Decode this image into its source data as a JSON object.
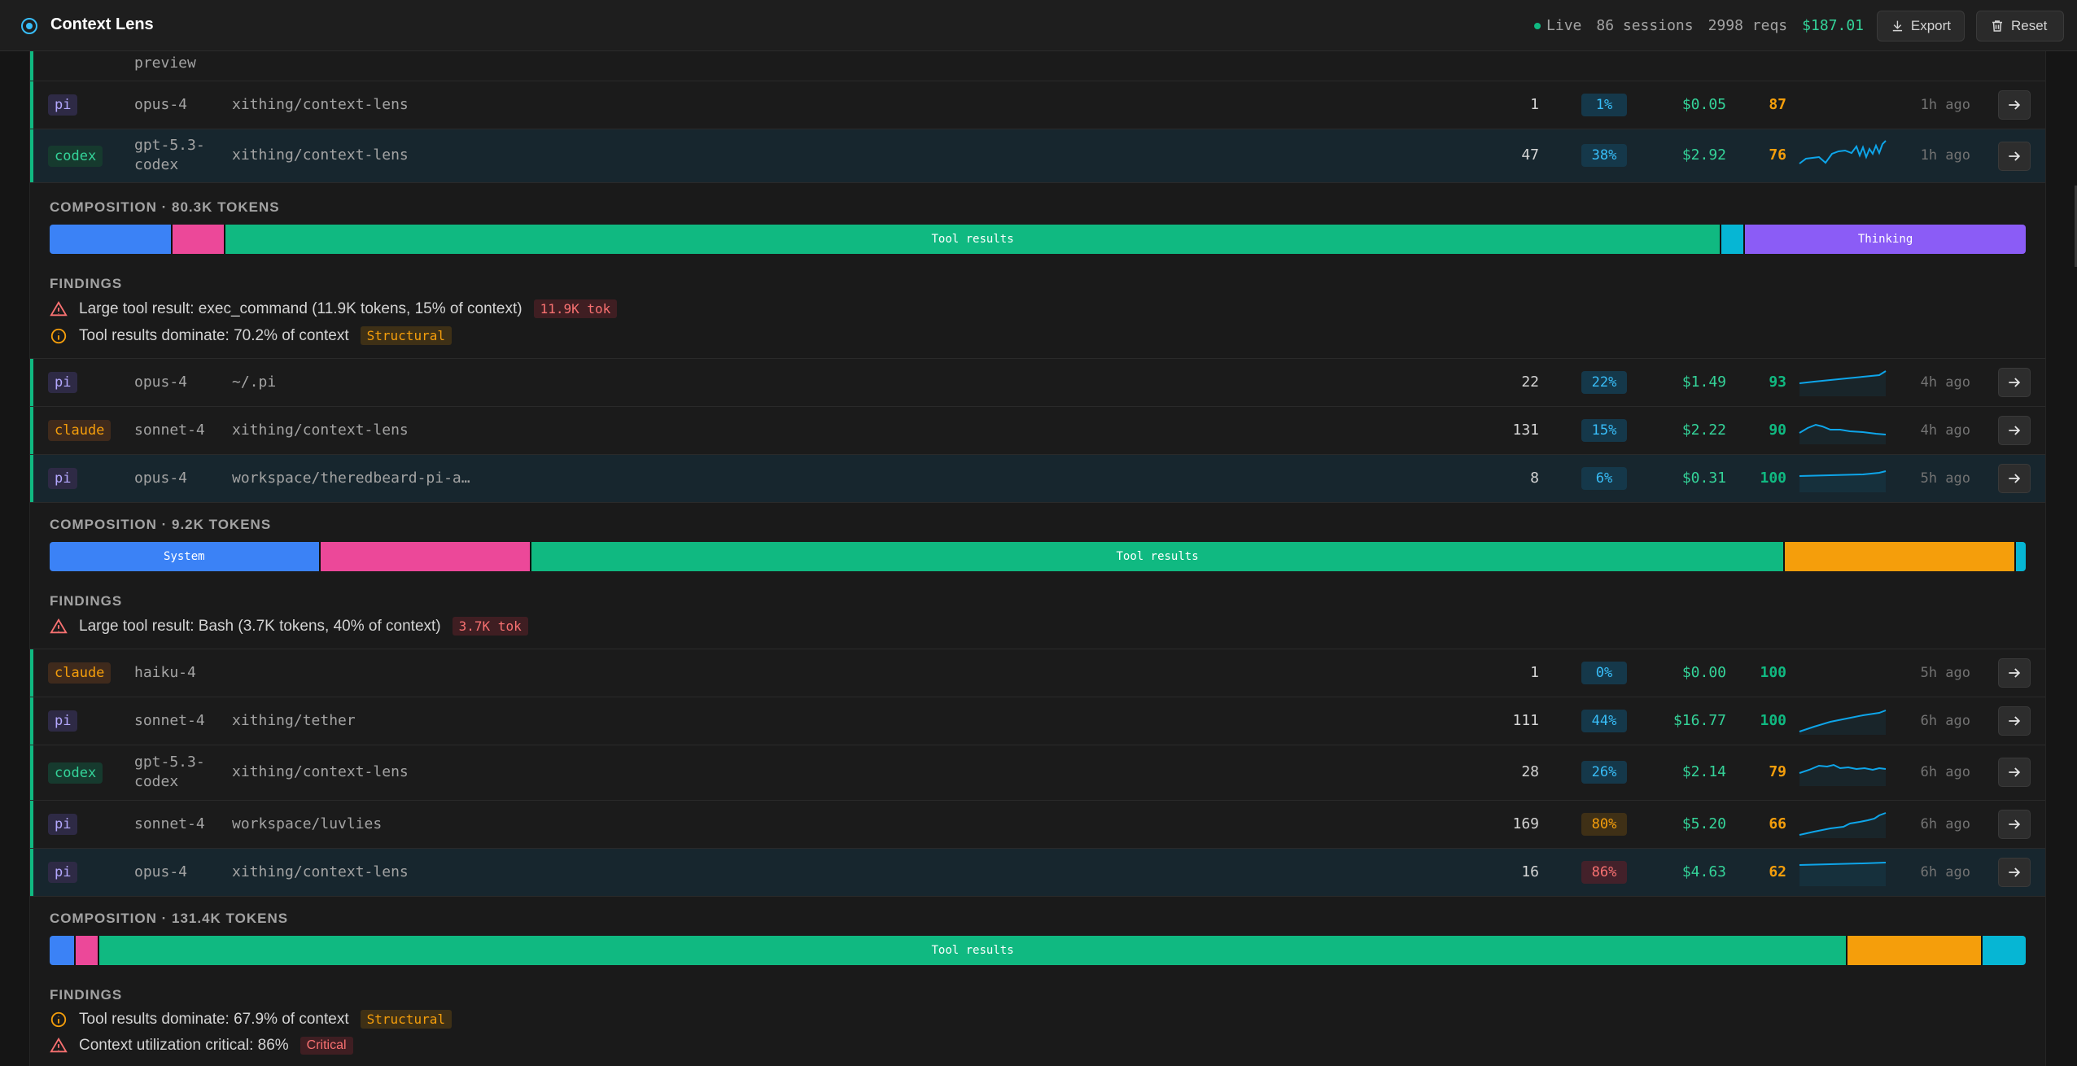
{
  "app": {
    "title": "Context Lens"
  },
  "header": {
    "live_label": "Live",
    "sessions": "86 sessions",
    "reqs": "2998 reqs",
    "cost": "$187.01",
    "export_label": "Export",
    "reset_label": "Reset"
  },
  "rows": [
    {
      "agent": "",
      "model": "preview",
      "project": "",
      "turns": "",
      "util": "",
      "cost": "",
      "score": "",
      "ago": ""
    },
    {
      "agent": "pi",
      "model": "opus-4",
      "project": "xithing/context-lens",
      "turns": "1",
      "util": "1%",
      "cost": "$0.05",
      "score": "87",
      "ago": "1h ago"
    },
    {
      "agent": "codex",
      "model_line1": "gpt-5.3-",
      "model_line2": "codex",
      "project": "xithing/context-lens",
      "turns": "47",
      "util": "38%",
      "cost": "$2.92",
      "score": "76",
      "ago": "1h ago"
    },
    {
      "agent": "pi",
      "model": "opus-4",
      "project": "~/.pi",
      "turns": "22",
      "util": "22%",
      "cost": "$1.49",
      "score": "93",
      "ago": "4h ago"
    },
    {
      "agent": "claude",
      "model": "sonnet-4",
      "project": "xithing/context-lens",
      "turns": "131",
      "util": "15%",
      "cost": "$2.22",
      "score": "90",
      "ago": "4h ago"
    },
    {
      "agent": "pi",
      "model": "opus-4",
      "project": "workspace/theredbeard-pi-a…",
      "turns": "8",
      "util": "6%",
      "cost": "$0.31",
      "score": "100",
      "ago": "5h ago"
    },
    {
      "agent": "claude",
      "model": "haiku-4",
      "project": "",
      "turns": "1",
      "util": "0%",
      "cost": "$0.00",
      "score": "100",
      "ago": "5h ago"
    },
    {
      "agent": "pi",
      "model": "sonnet-4",
      "project": "xithing/tether",
      "turns": "111",
      "util": "44%",
      "cost": "$16.77",
      "score": "100",
      "ago": "6h ago"
    },
    {
      "agent": "codex",
      "model_line1": "gpt-5.3-",
      "model_line2": "codex",
      "project": "xithing/context-lens",
      "turns": "28",
      "util": "26%",
      "cost": "$2.14",
      "score": "79",
      "ago": "6h ago"
    },
    {
      "agent": "pi",
      "model": "sonnet-4",
      "project": "workspace/luvlies",
      "turns": "169",
      "util": "80%",
      "cost": "$5.20",
      "score": "66",
      "ago": "6h ago"
    },
    {
      "agent": "pi",
      "model": "opus-4",
      "project": "xithing/context-lens",
      "turns": "16",
      "util": "86%",
      "cost": "$4.63",
      "score": "62",
      "ago": "6h ago"
    }
  ],
  "details": [
    {
      "composition_title": "COMPOSITION · 80.3K TOKENS",
      "segments": [
        {
          "label": "",
          "share": 0.062,
          "color": "#3b82f6"
        },
        {
          "label": "",
          "share": 0.027,
          "color": "#ec4899"
        },
        {
          "label": "Tool results",
          "share": 0.757,
          "color": "#10b981"
        },
        {
          "label": "",
          "share": 0.012,
          "color": "#06b6d4"
        },
        {
          "label": "Thinking",
          "share": 0.142,
          "color": "#8b5cf6"
        }
      ],
      "findings_title": "FINDINGS",
      "findings": [
        {
          "icon": "warning-icon",
          "text": "Large tool result: exec_command (11.9K tokens, 15% of context)",
          "tag": "11.9K tok"
        },
        {
          "icon": "info-icon",
          "text": "Tool results dominate: 70.2% of context",
          "tag": "Structural"
        }
      ]
    },
    {
      "composition_title": "COMPOSITION · 9.2K TOKENS",
      "segments": [
        {
          "label": "System",
          "share": 0.137,
          "color": "#3b82f6"
        },
        {
          "label": "",
          "share": 0.107,
          "color": "#ec4899"
        },
        {
          "label": "Tool results",
          "share": 0.634,
          "color": "#10b981"
        },
        {
          "label": "",
          "share": 0.117,
          "color": "#f59e0b"
        },
        {
          "label": "",
          "share": 0.005,
          "color": "#06b6d4"
        }
      ],
      "findings_title": "FINDINGS",
      "findings": [
        {
          "icon": "warning-icon",
          "text": "Large tool result: Bash (3.7K tokens, 40% of context)",
          "tag": "3.7K tok"
        }
      ]
    },
    {
      "composition_title": "COMPOSITION · 131.4K TOKENS",
      "segments": [
        {
          "label": "",
          "share": 0.013,
          "color": "#3b82f6"
        },
        {
          "label": "",
          "share": 0.012,
          "color": "#ec4899"
        },
        {
          "label": "Tool results",
          "share": 0.885,
          "color": "#10b981"
        },
        {
          "label": "",
          "share": 0.068,
          "color": "#f59e0b"
        },
        {
          "label": "",
          "share": 0.022,
          "color": "#06b6d4"
        }
      ],
      "findings_title": "FINDINGS",
      "findings": [
        {
          "icon": "info-icon",
          "text": "Tool results dominate: 67.9% of context",
          "tag": "Structural"
        },
        {
          "icon": "warning-icon",
          "text": "Context utilization critical: 86%",
          "tag": "Critical"
        }
      ]
    }
  ],
  "colors": {
    "accent": "#10b981",
    "cost": "#34d399",
    "warning": "#f87171",
    "amber": "#f59e0b",
    "sparkline": "#0ea5e9"
  }
}
